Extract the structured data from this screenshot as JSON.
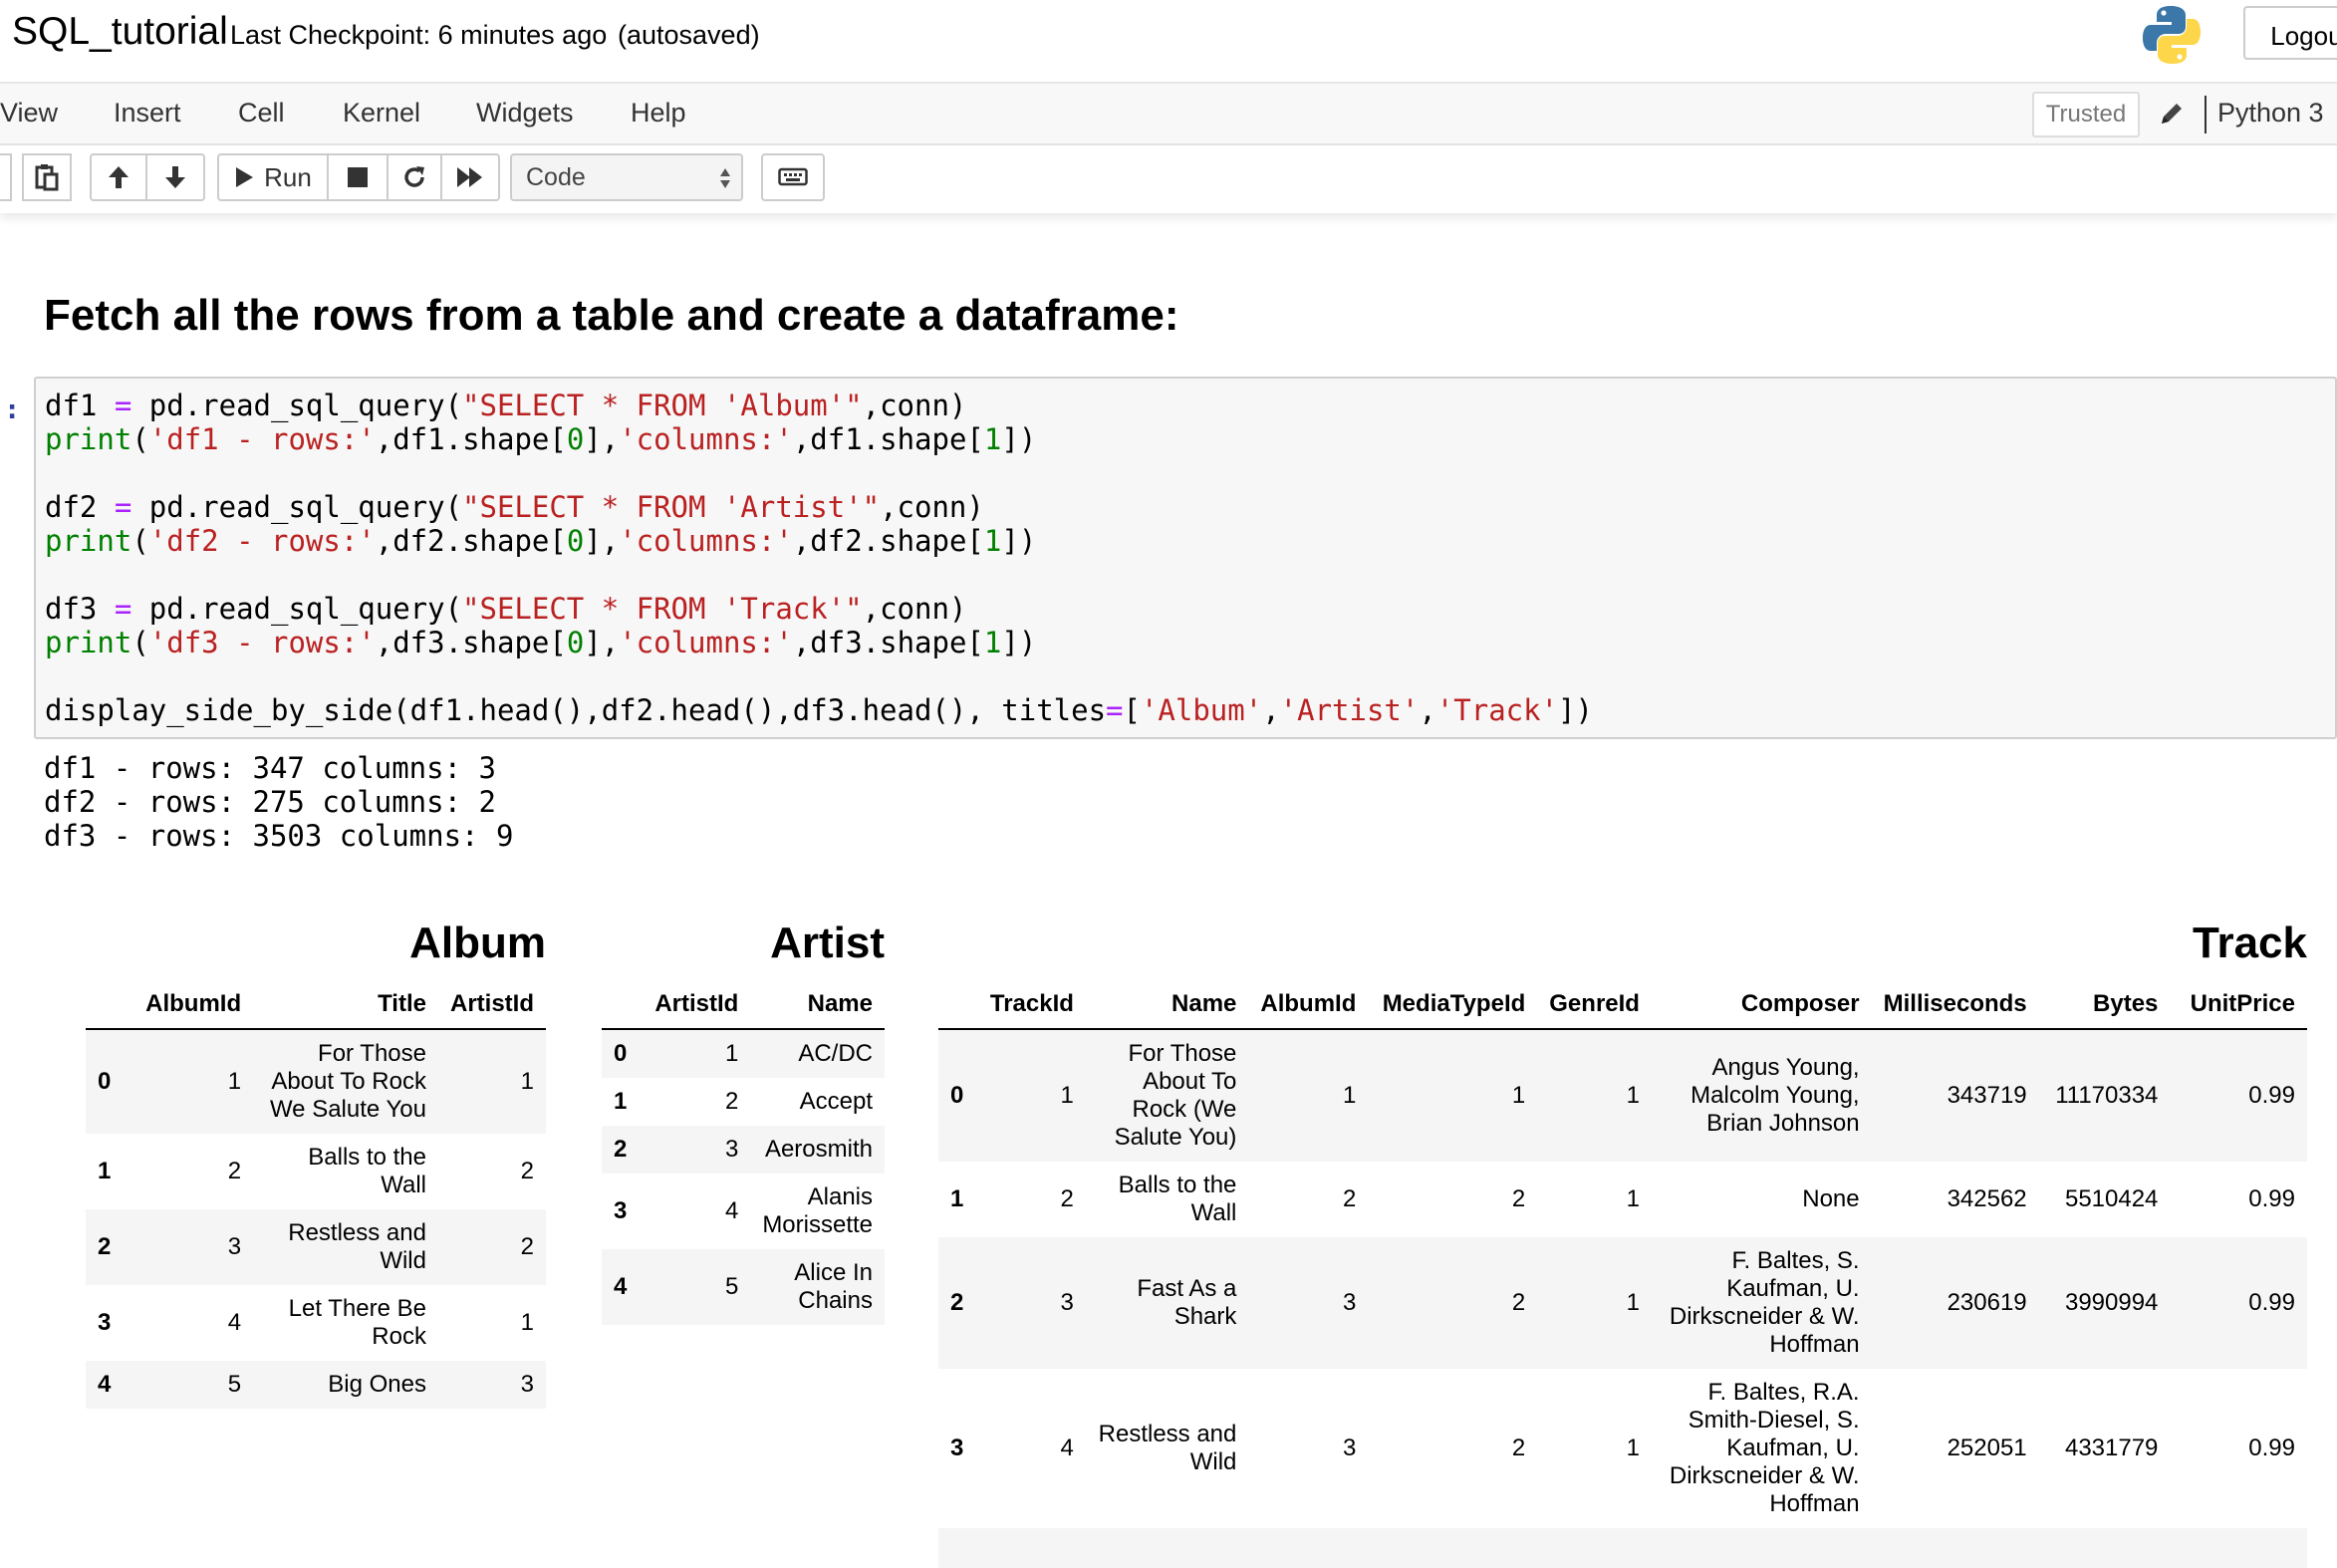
{
  "header": {
    "notebook_name": "SQL_tutorial",
    "checkpoint": "Last Checkpoint: 6 minutes ago",
    "autosave": "(autosaved)",
    "logout_label": "Logout"
  },
  "menubar": {
    "items": [
      "View",
      "Insert",
      "Cell",
      "Kernel",
      "Widgets",
      "Help"
    ],
    "trusted_label": "Trusted",
    "kernel_name": "Python 3"
  },
  "toolbar": {
    "run_label": "Run",
    "cell_type": "Code"
  },
  "markdown_heading": "Fetch all the rows from a table and create a dataframe:",
  "input_prompt": ":",
  "code_lines": [
    "df1 = pd.read_sql_query(\"SELECT * FROM 'Album'\",conn)",
    "print('df1 - rows:',df1.shape[0],'columns:',df1.shape[1])",
    "",
    "df2 = pd.read_sql_query(\"SELECT * FROM 'Artist'\",conn)",
    "print('df2 - rows:',df2.shape[0],'columns:',df2.shape[1])",
    "",
    "df3 = pd.read_sql_query(\"SELECT * FROM 'Track'\",conn)",
    "print('df3 - rows:',df3.shape[0],'columns:',df3.shape[1])",
    "",
    "display_side_by_side(df1.head(),df2.head(),df3.head(), titles=['Album','Artist','Track'])"
  ],
  "output_lines": [
    "df1 - rows: 347 columns: 3",
    "df2 - rows: 275 columns: 2",
    "df3 - rows: 3503 columns: 9"
  ],
  "tables": {
    "album": {
      "title": "Album",
      "columns": [
        "AlbumId",
        "Title",
        "ArtistId"
      ],
      "rows": [
        {
          "index": "0",
          "cells": [
            "1",
            "For Those About To Rock We Salute You",
            "1"
          ]
        },
        {
          "index": "1",
          "cells": [
            "2",
            "Balls to the Wall",
            "2"
          ]
        },
        {
          "index": "2",
          "cells": [
            "3",
            "Restless and Wild",
            "2"
          ]
        },
        {
          "index": "3",
          "cells": [
            "4",
            "Let There Be Rock",
            "1"
          ]
        },
        {
          "index": "4",
          "cells": [
            "5",
            "Big Ones",
            "3"
          ]
        }
      ]
    },
    "artist": {
      "title": "Artist",
      "columns": [
        "ArtistId",
        "Name"
      ],
      "rows": [
        {
          "index": "0",
          "cells": [
            "1",
            "AC/DC"
          ]
        },
        {
          "index": "1",
          "cells": [
            "2",
            "Accept"
          ]
        },
        {
          "index": "2",
          "cells": [
            "3",
            "Aerosmith"
          ]
        },
        {
          "index": "3",
          "cells": [
            "4",
            "Alanis Morissette"
          ]
        },
        {
          "index": "4",
          "cells": [
            "5",
            "Alice In Chains"
          ]
        }
      ]
    },
    "track": {
      "title": "Track",
      "columns": [
        "TrackId",
        "Name",
        "AlbumId",
        "MediaTypeId",
        "GenreId",
        "Composer",
        "Milliseconds",
        "Bytes",
        "UnitPrice"
      ],
      "rows": [
        {
          "index": "0",
          "cells": [
            "1",
            "For Those About To Rock (We Salute You)",
            "1",
            "1",
            "1",
            "Angus Young, Malcolm Young, Brian Johnson",
            "343719",
            "11170334",
            "0.99"
          ]
        },
        {
          "index": "1",
          "cells": [
            "2",
            "Balls to the Wall",
            "2",
            "2",
            "1",
            "None",
            "342562",
            "5510424",
            "0.99"
          ]
        },
        {
          "index": "2",
          "cells": [
            "3",
            "Fast As a Shark",
            "3",
            "2",
            "1",
            "F. Baltes, S. Kaufman, U. Dirkscneider & W. Hoffman",
            "230619",
            "3990994",
            "0.99"
          ]
        },
        {
          "index": "3",
          "cells": [
            "4",
            "Restless and Wild",
            "3",
            "2",
            "1",
            "F. Baltes, R.A. Smith-Diesel, S. Kaufman, U. Dirkscneider & W. Hoffman",
            "252051",
            "4331779",
            "0.99"
          ]
        }
      ]
    }
  }
}
